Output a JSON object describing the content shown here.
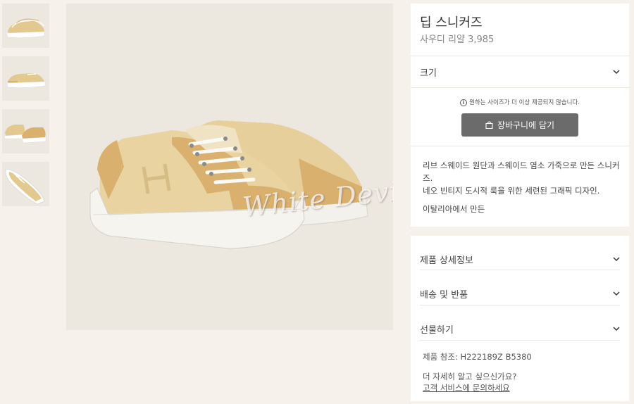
{
  "product": {
    "title": "딥 스니커즈",
    "price": "사우디 리얄 3,985"
  },
  "size_selector": {
    "label": "크기"
  },
  "availability_notice": "원하는 사이즈가 더 이상 제공되지 않습니다.",
  "cart_button": {
    "label": "장바구니에 담기",
    "icon": "shopping-bag-icon"
  },
  "description": {
    "line1": "리브 스웨이드 원단과 스웨이드 염소 가죽으로 만든 스니커즈.",
    "line2": "네오 빈티지 도시적 룩을 위한 세련된 그래픽 디자인.",
    "origin": "이탈리아에서 만든"
  },
  "accordions": [
    {
      "label": "제품 상세정보"
    },
    {
      "label": "배송 및 반품"
    },
    {
      "label": "선물하기"
    }
  ],
  "reference": "제품 참조: H222189Z B5380",
  "help": {
    "question": "더 자세히 알고 싶으신가요?",
    "link": "고객 서비스에 문의하세요"
  },
  "watermark": "White Devil",
  "thumbnails": [
    {
      "name": "thumbnail-pair-side"
    },
    {
      "name": "thumbnail-single-side"
    },
    {
      "name": "thumbnail-pair-back"
    },
    {
      "name": "thumbnail-top-view"
    }
  ],
  "colors": {
    "background": "#f6f1eb",
    "image_bg": "#ece7df",
    "button_bg": "#6b6b6b",
    "canvas_beige": "#e6cf9a",
    "suede_tan": "#d9b06e"
  }
}
